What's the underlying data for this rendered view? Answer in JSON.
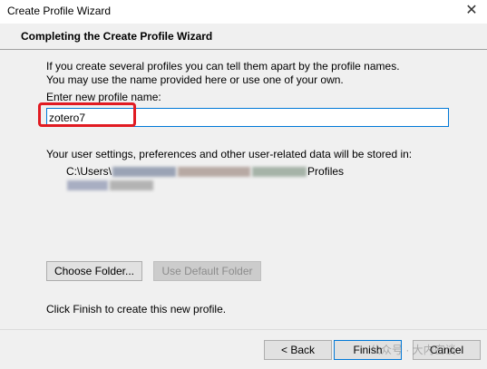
{
  "window": {
    "title": "Create Profile Wizard",
    "close_glyph": "✕"
  },
  "header": {
    "heading": "Completing the Create Profile Wizard"
  },
  "description": {
    "line1": "If you create several profiles you can tell them apart by the profile names.",
    "line2": "You may use the name provided here or use one of your own."
  },
  "profile_name": {
    "label": "Enter new profile name:",
    "value": "zotero7"
  },
  "storage": {
    "label": "Your user settings, preferences and other user-related data will be stored in:",
    "path_prefix": "C:\\Users\\",
    "path_suffix": "Profiles"
  },
  "buttons": {
    "choose_folder": "Choose Folder...",
    "use_default_folder": "Use Default Folder",
    "back": "< Back",
    "finish": "Finish",
    "cancel": "Cancel"
  },
  "finish_hint": "Click Finish to create this new profile.",
  "watermark": {
    "text": "公众号 · 大内密谈"
  },
  "colors": {
    "highlight": "#e11b22",
    "focus_border": "#0078d7"
  }
}
